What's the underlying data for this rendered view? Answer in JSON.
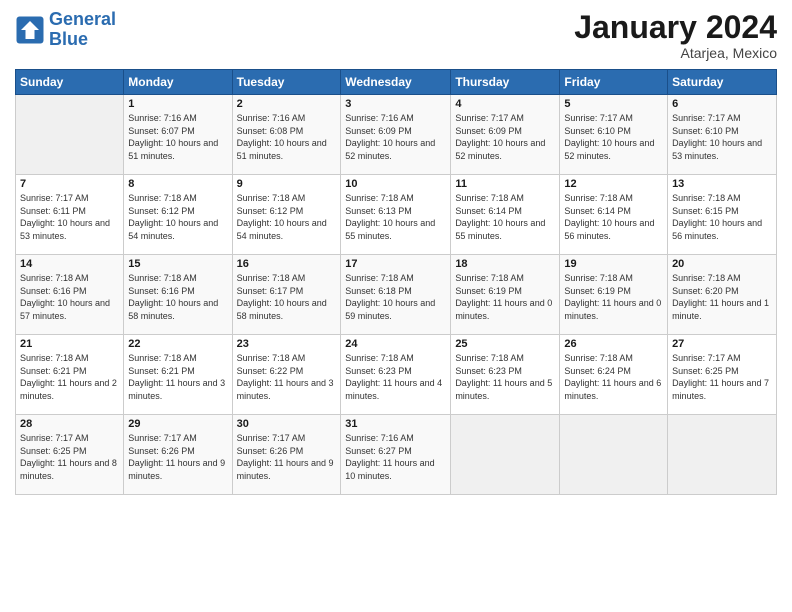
{
  "header": {
    "logo_line1": "General",
    "logo_line2": "Blue",
    "month_title": "January 2024",
    "subtitle": "Atarjea, Mexico"
  },
  "weekdays": [
    "Sunday",
    "Monday",
    "Tuesday",
    "Wednesday",
    "Thursday",
    "Friday",
    "Saturday"
  ],
  "weeks": [
    [
      {
        "day": "",
        "sunrise": "",
        "sunset": "",
        "daylight": ""
      },
      {
        "day": "1",
        "sunrise": "Sunrise: 7:16 AM",
        "sunset": "Sunset: 6:07 PM",
        "daylight": "Daylight: 10 hours and 51 minutes."
      },
      {
        "day": "2",
        "sunrise": "Sunrise: 7:16 AM",
        "sunset": "Sunset: 6:08 PM",
        "daylight": "Daylight: 10 hours and 51 minutes."
      },
      {
        "day": "3",
        "sunrise": "Sunrise: 7:16 AM",
        "sunset": "Sunset: 6:09 PM",
        "daylight": "Daylight: 10 hours and 52 minutes."
      },
      {
        "day": "4",
        "sunrise": "Sunrise: 7:17 AM",
        "sunset": "Sunset: 6:09 PM",
        "daylight": "Daylight: 10 hours and 52 minutes."
      },
      {
        "day": "5",
        "sunrise": "Sunrise: 7:17 AM",
        "sunset": "Sunset: 6:10 PM",
        "daylight": "Daylight: 10 hours and 52 minutes."
      },
      {
        "day": "6",
        "sunrise": "Sunrise: 7:17 AM",
        "sunset": "Sunset: 6:10 PM",
        "daylight": "Daylight: 10 hours and 53 minutes."
      }
    ],
    [
      {
        "day": "7",
        "sunrise": "Sunrise: 7:17 AM",
        "sunset": "Sunset: 6:11 PM",
        "daylight": "Daylight: 10 hours and 53 minutes."
      },
      {
        "day": "8",
        "sunrise": "Sunrise: 7:18 AM",
        "sunset": "Sunset: 6:12 PM",
        "daylight": "Daylight: 10 hours and 54 minutes."
      },
      {
        "day": "9",
        "sunrise": "Sunrise: 7:18 AM",
        "sunset": "Sunset: 6:12 PM",
        "daylight": "Daylight: 10 hours and 54 minutes."
      },
      {
        "day": "10",
        "sunrise": "Sunrise: 7:18 AM",
        "sunset": "Sunset: 6:13 PM",
        "daylight": "Daylight: 10 hours and 55 minutes."
      },
      {
        "day": "11",
        "sunrise": "Sunrise: 7:18 AM",
        "sunset": "Sunset: 6:14 PM",
        "daylight": "Daylight: 10 hours and 55 minutes."
      },
      {
        "day": "12",
        "sunrise": "Sunrise: 7:18 AM",
        "sunset": "Sunset: 6:14 PM",
        "daylight": "Daylight: 10 hours and 56 minutes."
      },
      {
        "day": "13",
        "sunrise": "Sunrise: 7:18 AM",
        "sunset": "Sunset: 6:15 PM",
        "daylight": "Daylight: 10 hours and 56 minutes."
      }
    ],
    [
      {
        "day": "14",
        "sunrise": "Sunrise: 7:18 AM",
        "sunset": "Sunset: 6:16 PM",
        "daylight": "Daylight: 10 hours and 57 minutes."
      },
      {
        "day": "15",
        "sunrise": "Sunrise: 7:18 AM",
        "sunset": "Sunset: 6:16 PM",
        "daylight": "Daylight: 10 hours and 58 minutes."
      },
      {
        "day": "16",
        "sunrise": "Sunrise: 7:18 AM",
        "sunset": "Sunset: 6:17 PM",
        "daylight": "Daylight: 10 hours and 58 minutes."
      },
      {
        "day": "17",
        "sunrise": "Sunrise: 7:18 AM",
        "sunset": "Sunset: 6:18 PM",
        "daylight": "Daylight: 10 hours and 59 minutes."
      },
      {
        "day": "18",
        "sunrise": "Sunrise: 7:18 AM",
        "sunset": "Sunset: 6:19 PM",
        "daylight": "Daylight: 11 hours and 0 minutes."
      },
      {
        "day": "19",
        "sunrise": "Sunrise: 7:18 AM",
        "sunset": "Sunset: 6:19 PM",
        "daylight": "Daylight: 11 hours and 0 minutes."
      },
      {
        "day": "20",
        "sunrise": "Sunrise: 7:18 AM",
        "sunset": "Sunset: 6:20 PM",
        "daylight": "Daylight: 11 hours and 1 minute."
      }
    ],
    [
      {
        "day": "21",
        "sunrise": "Sunrise: 7:18 AM",
        "sunset": "Sunset: 6:21 PM",
        "daylight": "Daylight: 11 hours and 2 minutes."
      },
      {
        "day": "22",
        "sunrise": "Sunrise: 7:18 AM",
        "sunset": "Sunset: 6:21 PM",
        "daylight": "Daylight: 11 hours and 3 minutes."
      },
      {
        "day": "23",
        "sunrise": "Sunrise: 7:18 AM",
        "sunset": "Sunset: 6:22 PM",
        "daylight": "Daylight: 11 hours and 3 minutes."
      },
      {
        "day": "24",
        "sunrise": "Sunrise: 7:18 AM",
        "sunset": "Sunset: 6:23 PM",
        "daylight": "Daylight: 11 hours and 4 minutes."
      },
      {
        "day": "25",
        "sunrise": "Sunrise: 7:18 AM",
        "sunset": "Sunset: 6:23 PM",
        "daylight": "Daylight: 11 hours and 5 minutes."
      },
      {
        "day": "26",
        "sunrise": "Sunrise: 7:18 AM",
        "sunset": "Sunset: 6:24 PM",
        "daylight": "Daylight: 11 hours and 6 minutes."
      },
      {
        "day": "27",
        "sunrise": "Sunrise: 7:17 AM",
        "sunset": "Sunset: 6:25 PM",
        "daylight": "Daylight: 11 hours and 7 minutes."
      }
    ],
    [
      {
        "day": "28",
        "sunrise": "Sunrise: 7:17 AM",
        "sunset": "Sunset: 6:25 PM",
        "daylight": "Daylight: 11 hours and 8 minutes."
      },
      {
        "day": "29",
        "sunrise": "Sunrise: 7:17 AM",
        "sunset": "Sunset: 6:26 PM",
        "daylight": "Daylight: 11 hours and 9 minutes."
      },
      {
        "day": "30",
        "sunrise": "Sunrise: 7:17 AM",
        "sunset": "Sunset: 6:26 PM",
        "daylight": "Daylight: 11 hours and 9 minutes."
      },
      {
        "day": "31",
        "sunrise": "Sunrise: 7:16 AM",
        "sunset": "Sunset: 6:27 PM",
        "daylight": "Daylight: 11 hours and 10 minutes."
      },
      {
        "day": "",
        "sunrise": "",
        "sunset": "",
        "daylight": ""
      },
      {
        "day": "",
        "sunrise": "",
        "sunset": "",
        "daylight": ""
      },
      {
        "day": "",
        "sunrise": "",
        "sunset": "",
        "daylight": ""
      }
    ]
  ]
}
